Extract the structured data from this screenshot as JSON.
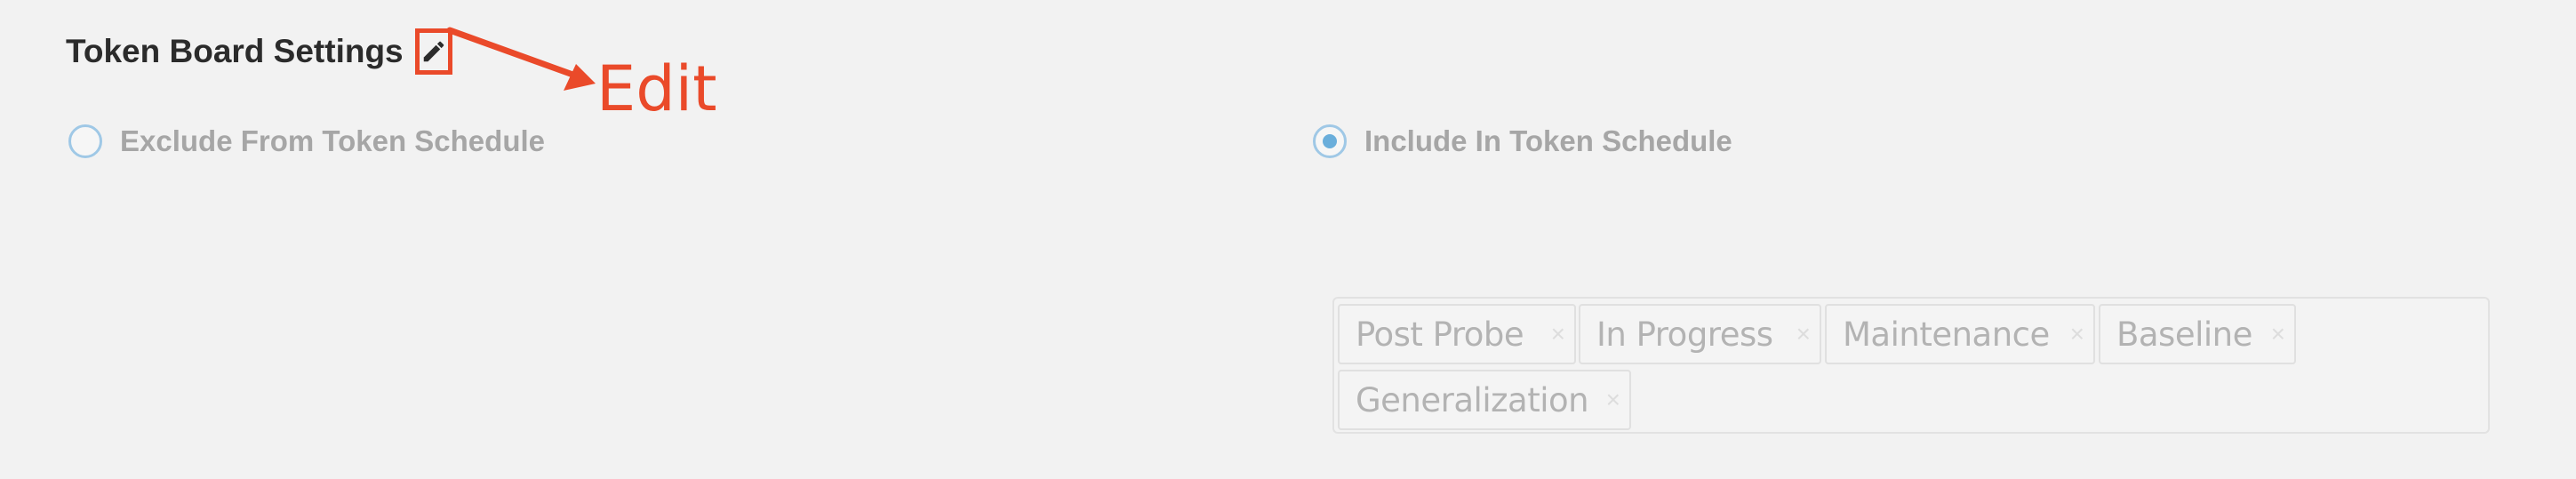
{
  "settings": {
    "title": "Token Board Settings",
    "edit_icon": "pencil-icon"
  },
  "annotation": {
    "label": "Edit",
    "color": "#ea4a2a"
  },
  "options": [
    {
      "label": "Exclude From Token Schedule",
      "selected": false
    },
    {
      "label": "Include In Token Schedule",
      "selected": true
    }
  ],
  "tags": [
    {
      "label": "Post Probe",
      "remove_icon": "×"
    },
    {
      "label": "In Progress",
      "remove_icon": "×"
    },
    {
      "label": "Maintenance",
      "remove_icon": "×"
    },
    {
      "label": "Baseline",
      "remove_icon": "×"
    },
    {
      "label": "Generalization",
      "remove_icon": "×"
    }
  ]
}
